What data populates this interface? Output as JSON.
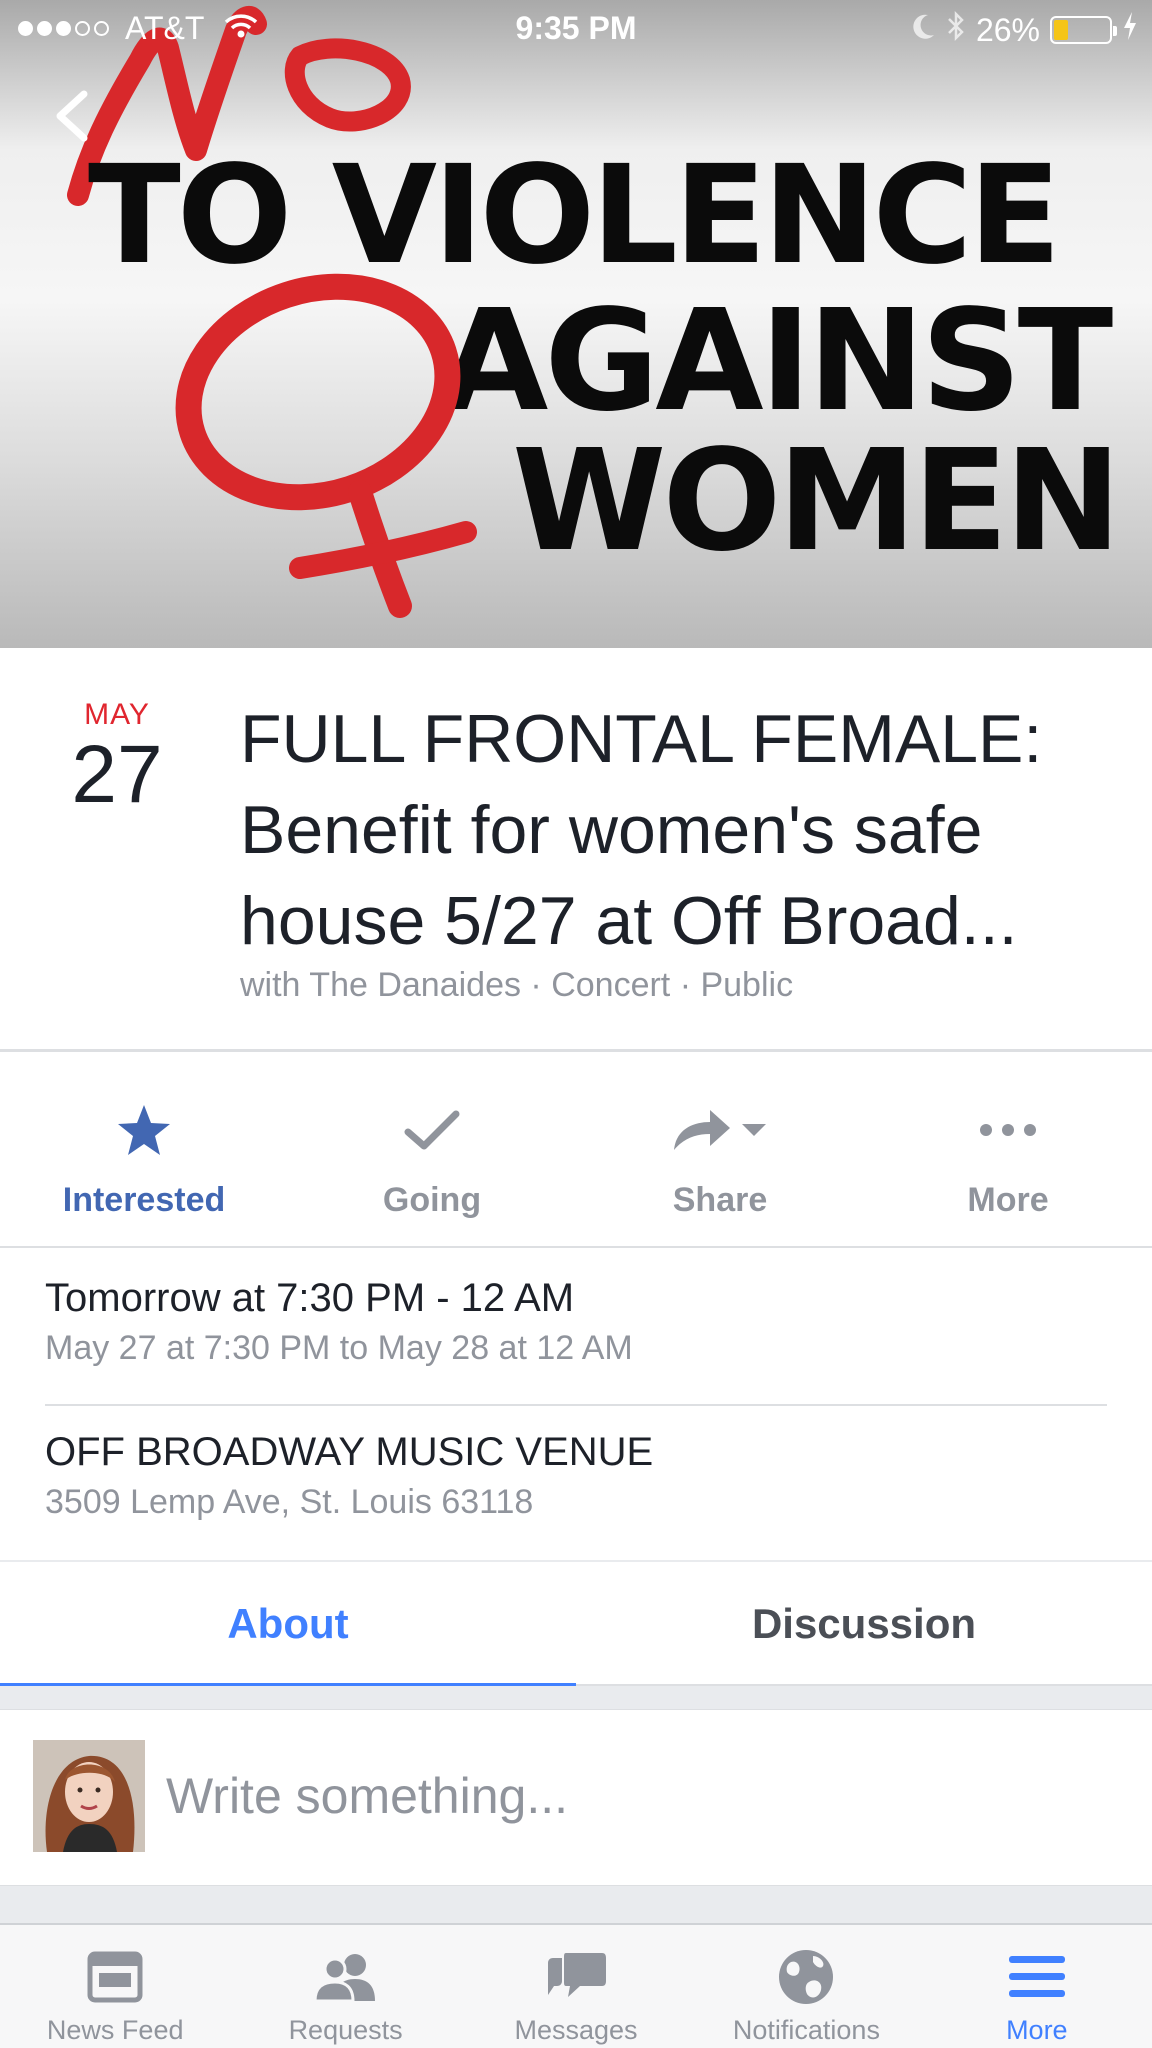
{
  "status_bar": {
    "carrier": "AT&T",
    "time": "9:35 PM",
    "battery": "26%",
    "battery_level": 0.26,
    "signal_bars": 3
  },
  "cover": {
    "line1": "TO VIOLENCE",
    "line2": "AGAINST",
    "line3": "WOMEN",
    "script_word": "No",
    "accent_color": "#d8282b",
    "text_color": "#0b0b0b",
    "icons": [
      "back-chevron-icon",
      "female-symbol-icon"
    ]
  },
  "event": {
    "month": "MAY",
    "day": "27",
    "title": "FULL FRONTAL FEMALE: Benefit for women's safe house 5/27 at Off Broad...",
    "subtitle": "with The Danaides · Concert · Public"
  },
  "actions": [
    {
      "label": "Interested",
      "icon": "star-icon",
      "active": true
    },
    {
      "label": "Going",
      "icon": "checkmark-icon",
      "active": false
    },
    {
      "label": "Share",
      "icon": "share-arrow-icon",
      "active": false
    },
    {
      "label": "More",
      "icon": "more-dots-icon",
      "active": false
    }
  ],
  "details": {
    "time_main": "Tomorrow at 7:30 PM - 12 AM",
    "time_sub": "May 27 at 7:30 PM to May 28 at 12 AM",
    "place_main": "OFF BROADWAY MUSIC VENUE",
    "place_sub": "3509 Lemp Ave, St. Louis 63118"
  },
  "tabs": [
    {
      "label": "About",
      "active": true
    },
    {
      "label": "Discussion",
      "active": false
    }
  ],
  "composer": {
    "placeholder": "Write something..."
  },
  "tab_bar": [
    {
      "label": "News Feed",
      "icon": "news-feed-icon",
      "active": false
    },
    {
      "label": "Requests",
      "icon": "friend-requests-icon",
      "active": false
    },
    {
      "label": "Messages",
      "icon": "messages-icon",
      "active": false
    },
    {
      "label": "Notifications",
      "icon": "globe-icon",
      "active": false
    },
    {
      "label": "More",
      "icon": "hamburger-menu-icon",
      "active": true
    }
  ],
  "colors": {
    "facebook_blue": "#4267b2",
    "link_blue": "#4080ff",
    "muted_gray": "#90949c",
    "date_red": "#e0262f"
  }
}
